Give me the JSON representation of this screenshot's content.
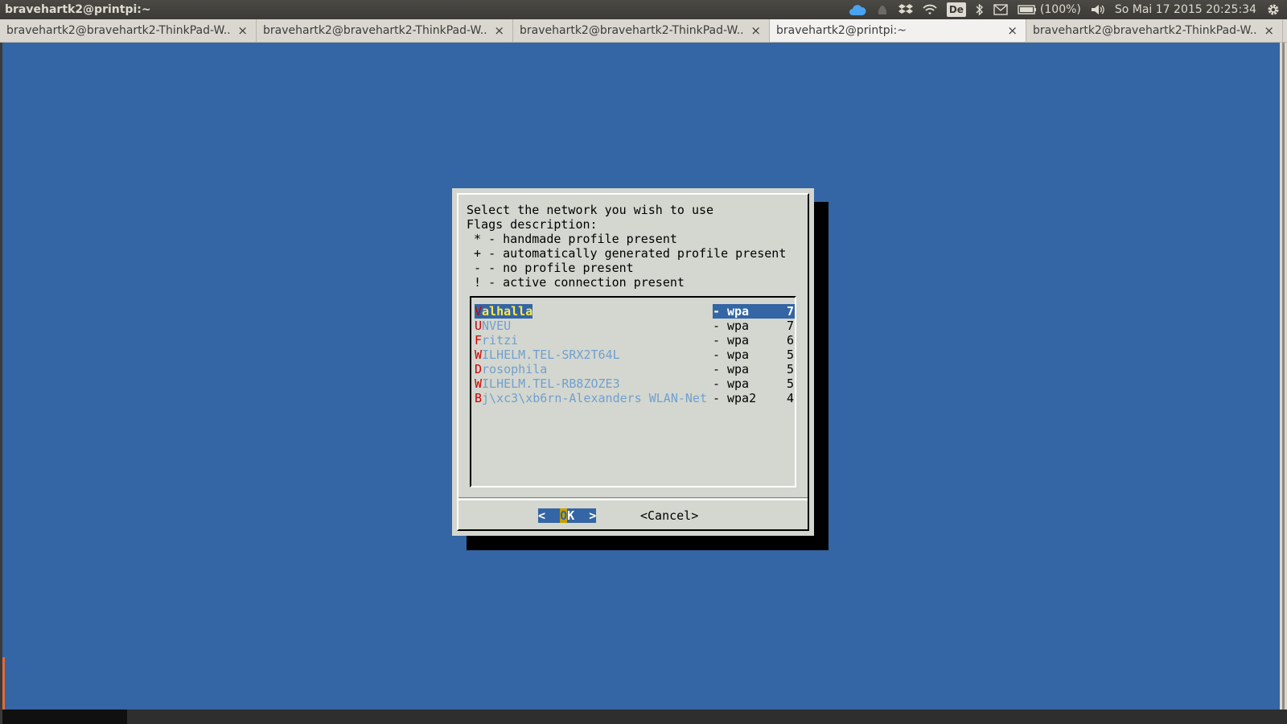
{
  "panel": {
    "title": "bravehartk2@printpi:~",
    "keyboard": "De",
    "battery": "(100%)",
    "clock": "So Mai 17 2015 20:25:34"
  },
  "tabs": [
    {
      "label": "bravehartk2@bravehartk2-ThinkPad-W...",
      "active": false
    },
    {
      "label": "bravehartk2@bravehartk2-ThinkPad-W...",
      "active": false
    },
    {
      "label": "bravehartk2@bravehartk2-ThinkPad-W...",
      "active": false
    },
    {
      "label": "bravehartk2@printpi:~",
      "active": true
    },
    {
      "label": "bravehartk2@bravehartk2-ThinkPad-W...",
      "active": false
    }
  ],
  "tab_close_glyph": "×",
  "dialog": {
    "prompt_lines": [
      "Select the network you wish to use",
      "Flags description:",
      " * - handmade profile present",
      " + - automatically generated profile present",
      " - - no profile present",
      " ! - active connection present"
    ],
    "networks": [
      {
        "hot": "V",
        "rest": "alhalla",
        "flag": "-",
        "security": "wpa",
        "signal": "7",
        "selected": true
      },
      {
        "hot": "U",
        "rest": "NVEU",
        "flag": "-",
        "security": "wpa",
        "signal": "7",
        "selected": false
      },
      {
        "hot": "F",
        "rest": "ritzi",
        "flag": "-",
        "security": "wpa",
        "signal": "6",
        "selected": false
      },
      {
        "hot": "W",
        "rest": "ILHELM.TEL-SRX2T64L",
        "flag": "-",
        "security": "wpa",
        "signal": "5",
        "selected": false
      },
      {
        "hot": "D",
        "rest": "rosophila",
        "flag": "-",
        "security": "wpa",
        "signal": "5",
        "selected": false
      },
      {
        "hot": "W",
        "rest": "ILHELM.TEL-RB8ZOZE3",
        "flag": "-",
        "security": "wpa",
        "signal": "5",
        "selected": false
      },
      {
        "hot": "B",
        "rest": "j\\xc3\\xb6rn-Alexanders WLAN-Net",
        "flag": "-",
        "security": "wpa2",
        "signal": "4",
        "selected": false
      }
    ],
    "ok": {
      "left": "<  ",
      "hot": "O",
      "rest": "K  >"
    },
    "cancel": "<Cancel>"
  },
  "colors": {
    "terminal_bg": "#3465a4",
    "dialog_bg": "#d3d7cf",
    "hotkey": "#cc0000",
    "item_text": "#729fcf",
    "selected_text": "#fce94f"
  }
}
